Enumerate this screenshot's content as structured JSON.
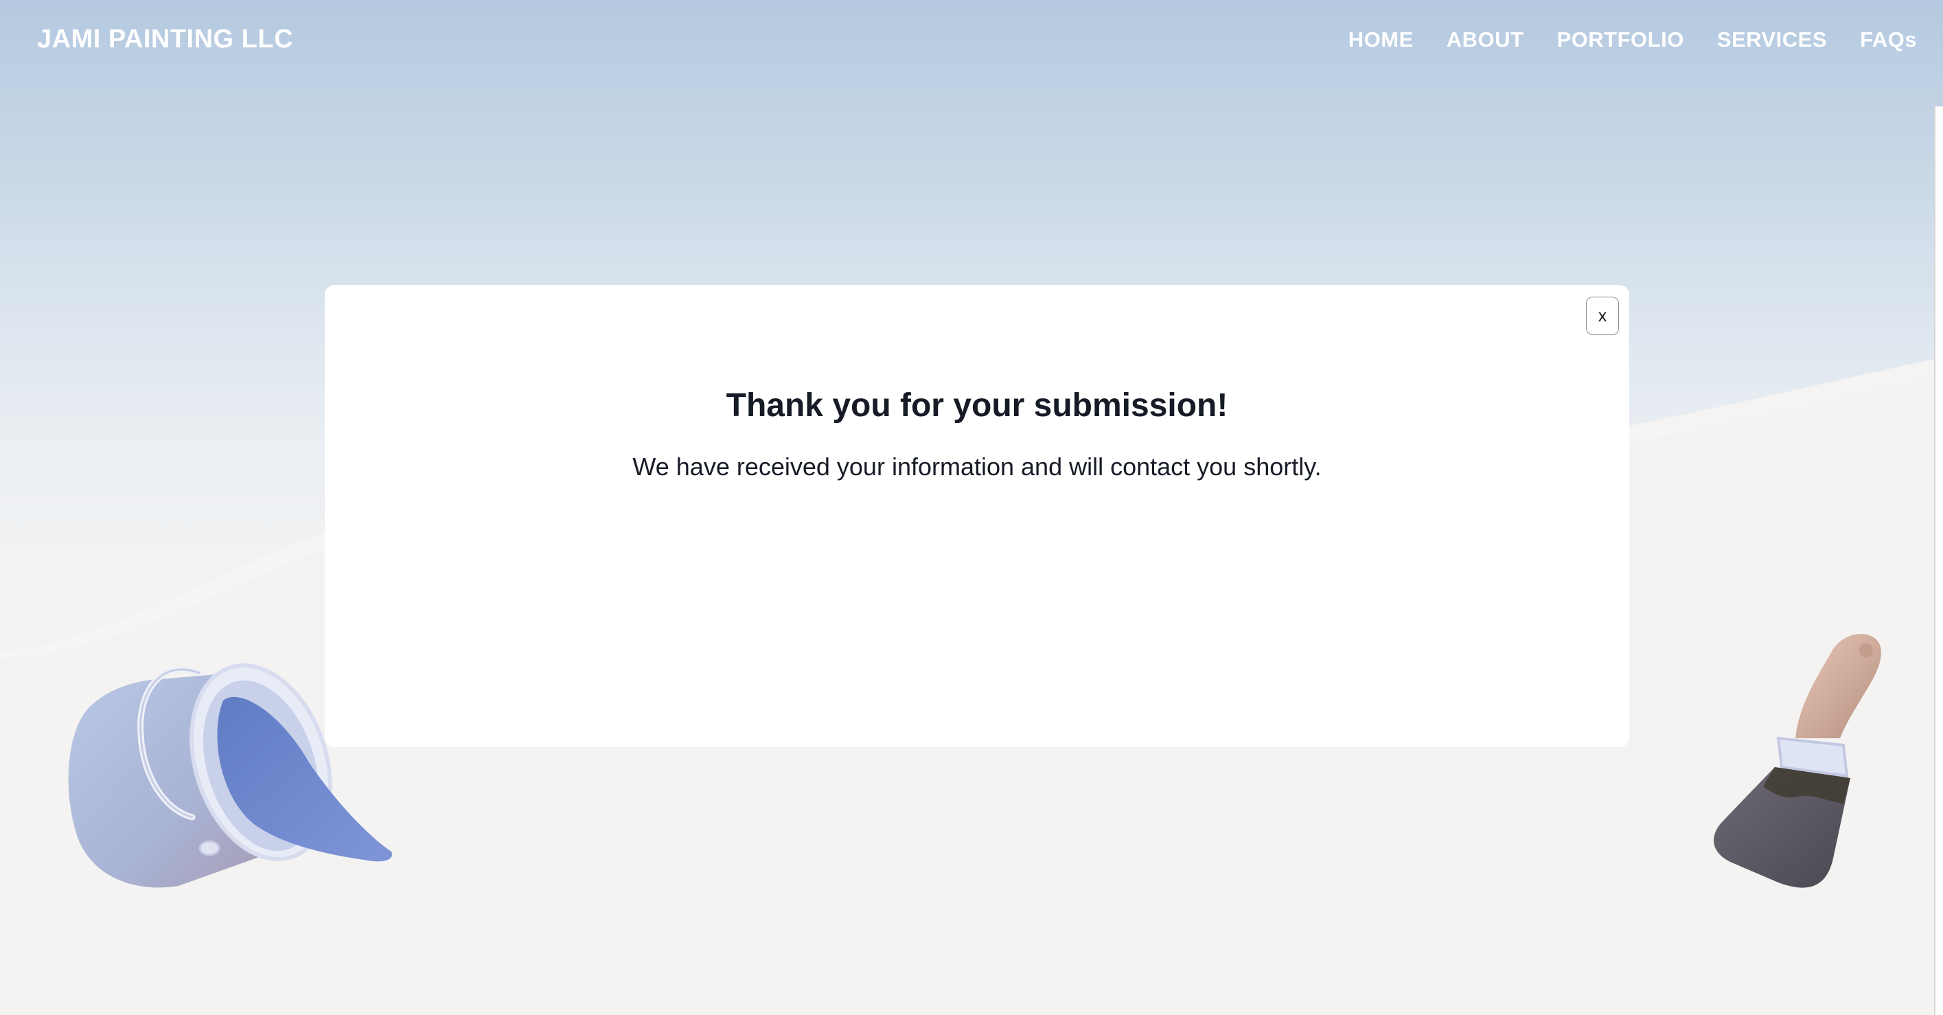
{
  "header": {
    "logo": "JAMI PAINTING LLC",
    "nav": [
      "HOME",
      "ABOUT",
      "PORTFOLIO",
      "SERVICES",
      "FAQs"
    ]
  },
  "modal": {
    "close_label": "x",
    "title": "Thank you for your submission!",
    "message": "We have received your information and will contact you shortly."
  },
  "decorations": {
    "left": "paint-bucket-icon",
    "right": "paint-brush-icon"
  },
  "colors": {
    "sky_top": "#b4c9e0",
    "ground": "#f4f2f0",
    "text_dark": "#161b26",
    "paint_blue": "#6b85c8"
  }
}
